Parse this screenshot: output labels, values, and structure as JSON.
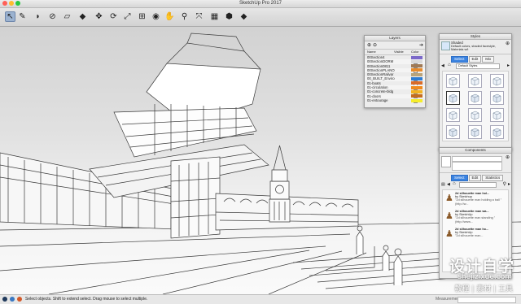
{
  "window": {
    "title": "SketchUp Pro 2017",
    "traffic_lights": [
      "#ff5f57",
      "#febc2e",
      "#28c840"
    ]
  },
  "toolbar": {
    "tools": [
      {
        "name": "select-tool",
        "glyph": "↖",
        "active": true
      },
      {
        "name": "pencil-tool",
        "glyph": "✎"
      },
      {
        "name": "paint-bucket-tool",
        "glyph": "◗"
      },
      {
        "name": "offset-tool",
        "glyph": "⊘"
      },
      {
        "name": "eraser-tool",
        "glyph": "▱"
      },
      {
        "name": "push-pull-tool",
        "glyph": "◆"
      },
      {
        "name": "move-tool",
        "glyph": "✥"
      },
      {
        "name": "rotate-tool",
        "glyph": "⟳"
      },
      {
        "name": "scale-tool",
        "glyph": "⤢"
      },
      {
        "name": "tape-measure-tool",
        "glyph": "⊞"
      },
      {
        "name": "orbit-tool",
        "glyph": "◉"
      },
      {
        "name": "pan-tool",
        "glyph": "✋"
      },
      {
        "name": "zoom-tool",
        "glyph": "⚲"
      },
      {
        "name": "zoom-extents-tool",
        "glyph": "⤧"
      },
      {
        "name": "warehouse-tool",
        "glyph": "▦"
      },
      {
        "name": "extension-warehouse-tool",
        "glyph": "⬢"
      },
      {
        "name": "share-model-tool",
        "glyph": "◆"
      }
    ]
  },
  "layers_panel": {
    "title": "Layers",
    "columns": {
      "name": "Name",
      "visible": "Visible",
      "color": "Color"
    },
    "rows": [
      {
        "name": "00Section4",
        "visible": false,
        "color": "#7b69c9"
      },
      {
        "name": "00SectionDORM",
        "visible": false,
        "color": "#d9d9d9"
      },
      {
        "name": "00Section0811",
        "visible": false,
        "color": "#a07a55"
      },
      {
        "name": "00SectionPLANO",
        "visible": false,
        "color": "#e88b2a"
      },
      {
        "name": "00SectionRailvar",
        "visible": false,
        "color": "#b9a37a"
      },
      {
        "name": "00_BUILT_Enviro",
        "visible": true,
        "color": "#2e7bd1"
      },
      {
        "name": "01-boats",
        "visible": true,
        "color": "#d96b28"
      },
      {
        "name": "01-circulation",
        "visible": true,
        "color": "#f08a1c"
      },
      {
        "name": "01-concrete-bldg",
        "visible": true,
        "color": "#f2b321"
      },
      {
        "name": "01-doors",
        "visible": true,
        "color": "#c56c1d"
      },
      {
        "name": "01-entourage",
        "visible": true,
        "color": "#f5ed2b"
      }
    ]
  },
  "styles_panel": {
    "title": "Styles",
    "current_name": "Shaded",
    "description": "Default colors, shaded facestyle, Materials w/t",
    "tabs": [
      "Select",
      "Edit",
      "Mix"
    ],
    "selected_tab": "Select",
    "collection": "Default Styles"
  },
  "components_panel": {
    "title": "Components",
    "tabs": [
      "Select",
      "Edit",
      "Statistics"
    ],
    "selected_tab": "Select",
    "items": [
      {
        "name": "2d silhouette man hol...",
        "author": "by Sketchup",
        "desc": "\"2d silhouette man holding a ball \" (http://w..."
      },
      {
        "name": "2d silhouette man wa...",
        "author": "by SketchUp",
        "desc": "\"2d silhouette man standing \" (http://www..."
      },
      {
        "name": "2d silhouette man ho...",
        "author": "by SketchUp",
        "desc": "\"2d silhouette man..."
      }
    ]
  },
  "status": {
    "message": "Select objects. Shift to extend select. Drag mouse to select multiple.",
    "measurements_label": "Measurements"
  },
  "watermark": {
    "title": "设计自学",
    "url": "shejizixue.com",
    "tagline": "教程 | 素材 | 工具"
  }
}
